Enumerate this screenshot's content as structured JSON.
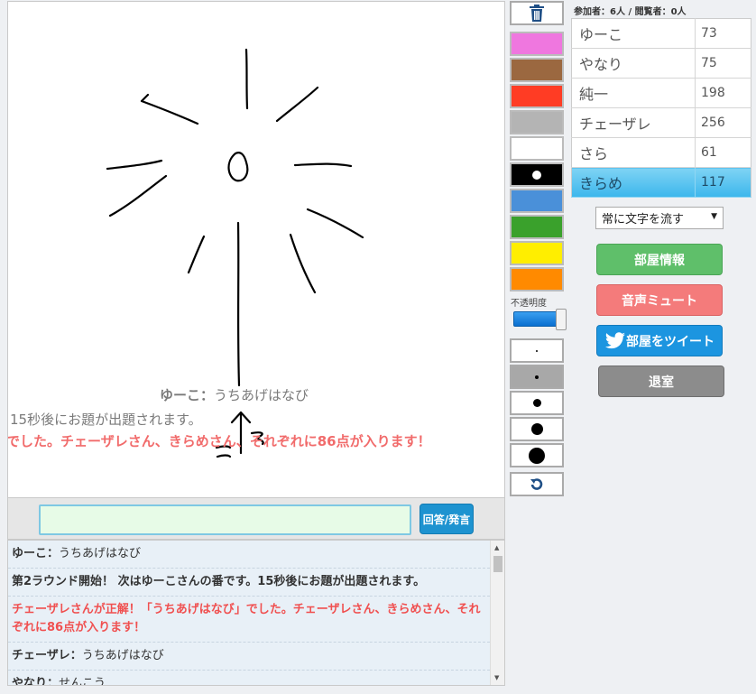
{
  "canvas_flow": {
    "line1_name": "ゆーこ：",
    "line1_text": "うちあげはなび",
    "line2_text": "15秒後にお題が出題されます。",
    "line3_text": "でした。チェーザレさん、きらめさん、それぞれに86点が入ります！"
  },
  "input": {
    "value": "",
    "button_label": "回答/発言"
  },
  "chat": [
    {
      "type": "message",
      "name": "ゆーこ：",
      "text": "うちあげはなび"
    },
    {
      "type": "system",
      "text": "第2ラウンド開始！ 次はゆーこさんの番です。15秒後にお題が出題されます。"
    },
    {
      "type": "correct",
      "text": "チェーザレさんが正解！「うちあげはなび」でした。チェーザレさん、きらめさん、それぞれに86点が入ります！"
    },
    {
      "type": "message",
      "name": "チェーザレ：",
      "text": "うちあげはなび"
    },
    {
      "type": "message",
      "name": "やなり：",
      "text": "せんこう"
    }
  ],
  "palette": {
    "colors": [
      "#ef77df",
      "#9b6840",
      "#ff3c24",
      "#b4b4b4",
      "#ffffff",
      "#000000",
      "#4a90d9",
      "#3aa12c",
      "#ffee00",
      "#ff8a00"
    ],
    "selected_index": 5
  },
  "opacity": {
    "label": "不透明度",
    "value": 1.0
  },
  "brush_sizes": [
    2,
    4,
    9,
    13,
    18
  ],
  "brush_selected_index": 1,
  "room": {
    "count_label": "参加者：6人 / 閲覧者：0人"
  },
  "players": [
    {
      "name": "ゆーこ",
      "score": "73",
      "active": false
    },
    {
      "name": "やなり",
      "score": "75",
      "active": false
    },
    {
      "name": "純一",
      "score": "198",
      "active": false
    },
    {
      "name": "チェーザレ",
      "score": "256",
      "active": false
    },
    {
      "name": "さら",
      "score": "61",
      "active": false
    },
    {
      "name": "きらめ",
      "score": "117",
      "active": true
    }
  ],
  "flow_mode": {
    "selected": "常に文字を流す"
  },
  "buttons": {
    "room_info": "部屋情報",
    "mute": "音声ミュート",
    "tweet": "部屋をツイート",
    "leave": "退室"
  },
  "icons": {
    "trash": "trash-icon",
    "undo": "undo-icon",
    "twitter": "twitter-bird-icon"
  }
}
